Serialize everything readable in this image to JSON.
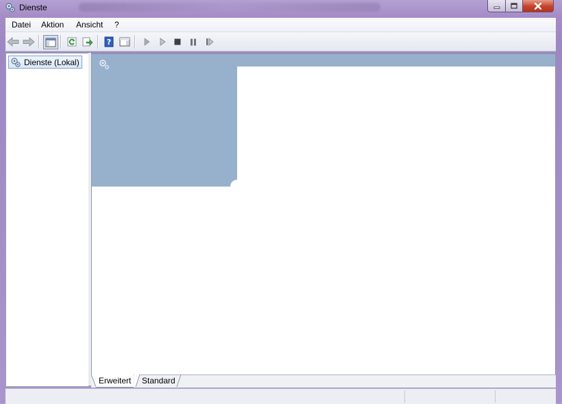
{
  "window": {
    "title": "Dienste",
    "controls": {
      "minimize_icon": "minimize-icon",
      "maximize_icon": "maximize-icon",
      "close_icon": "close-icon"
    }
  },
  "menu": {
    "items": [
      {
        "label": "Datei"
      },
      {
        "label": "Aktion"
      },
      {
        "label": "Ansicht"
      },
      {
        "label": "?"
      }
    ]
  },
  "toolbar": {
    "buttons": [
      {
        "name": "back",
        "icon": "arrow-left-icon"
      },
      {
        "name": "forward",
        "icon": "arrow-right-icon"
      },
      {
        "name": "show-console-tree",
        "icon": "console-tree-icon",
        "pressed": true
      },
      {
        "name": "refresh",
        "icon": "refresh-icon"
      },
      {
        "name": "export-list",
        "icon": "export-icon"
      },
      {
        "name": "help",
        "icon": "help-icon"
      },
      {
        "name": "show-action-pane",
        "icon": "action-pane-icon"
      },
      {
        "name": "start-service",
        "icon": "play-icon"
      },
      {
        "name": "start-service-alt",
        "icon": "play-outline-icon"
      },
      {
        "name": "stop-service",
        "icon": "stop-icon"
      },
      {
        "name": "pause-service",
        "icon": "pause-icon"
      },
      {
        "name": "restart-service",
        "icon": "restart-icon"
      }
    ]
  },
  "tree": {
    "root": {
      "label": "Dienste (Lokal)",
      "icon": "services-gear-icon"
    }
  },
  "tabs": [
    {
      "label": "Erweitert",
      "active": true
    },
    {
      "label": "Standard",
      "active": false
    }
  ],
  "colors": {
    "header_blue": "#97b1cd",
    "frame_purple": "#a58cc6",
    "close_red": "#c4432a"
  }
}
